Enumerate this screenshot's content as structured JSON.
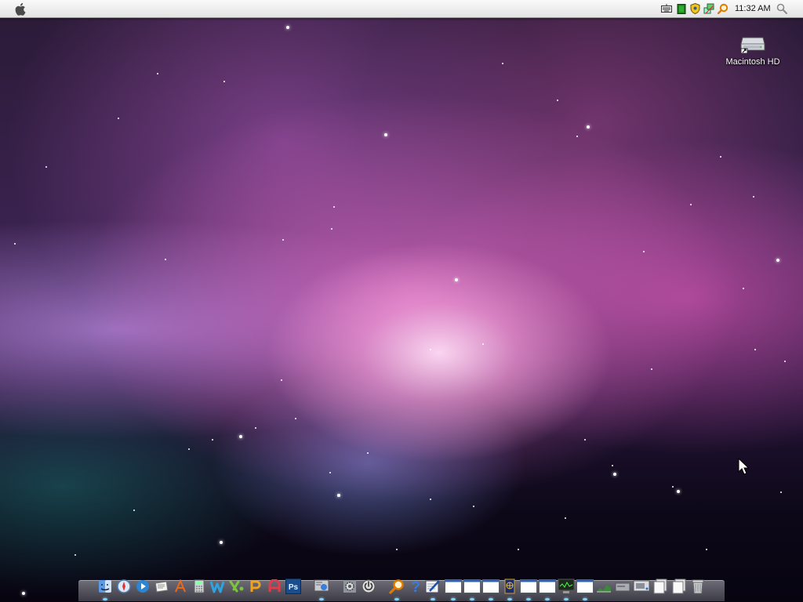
{
  "menubar": {
    "clock": "11:32 AM",
    "tray_icons": [
      "keyboard-icon",
      "battery-chip-icon",
      "security-shield-icon",
      "network-icon",
      "magnifier-tray-icon",
      "spotlight-icon"
    ]
  },
  "desktop": {
    "icons": [
      {
        "label": "Macintosh HD",
        "icon": "hard-drive-icon"
      }
    ]
  },
  "dock": {
    "items": [
      {
        "name": "finder",
        "icon": "finder-icon",
        "running": true
      },
      {
        "name": "safari",
        "icon": "safari-compass-icon"
      },
      {
        "name": "media-player",
        "icon": "media-player-icon"
      },
      {
        "name": "mail",
        "icon": "mail-icon"
      },
      {
        "name": "app-store",
        "icon": "app-store-icon"
      },
      {
        "name": "calculator",
        "icon": "calculator-icon"
      },
      {
        "name": "word",
        "icon": "w-icon"
      },
      {
        "name": "excel",
        "icon": "x-icon"
      },
      {
        "name": "powerpoint",
        "icon": "p-icon"
      },
      {
        "name": "access",
        "icon": "a-icon"
      },
      {
        "name": "photoshop",
        "icon": "photoshop-icon",
        "label": "Ps"
      },
      {
        "name": "network-settings",
        "icon": "network-settings-icon",
        "running": true
      },
      {
        "name": "system-preferences",
        "icon": "gear-icon"
      },
      {
        "name": "power",
        "icon": "power-icon"
      },
      {
        "name": "search",
        "icon": "search-icon",
        "running": true
      },
      {
        "name": "help",
        "icon": "help-icon",
        "label": "?"
      },
      {
        "name": "editor",
        "icon": "edit-icon",
        "running": true
      },
      {
        "name": "window-1",
        "icon": "window-icon",
        "running": true
      },
      {
        "name": "window-2",
        "icon": "window-icon",
        "running": true
      },
      {
        "name": "window-3",
        "icon": "window-icon",
        "running": true
      },
      {
        "name": "sync",
        "icon": "globe-window-icon",
        "running": true
      },
      {
        "name": "window-4",
        "icon": "window-icon",
        "running": true
      },
      {
        "name": "window-5",
        "icon": "window-icon",
        "running": true
      },
      {
        "name": "activity-monitor",
        "icon": "monitor-icon",
        "running": true
      },
      {
        "name": "window-6",
        "icon": "window-icon",
        "running": true
      },
      {
        "name": "chart",
        "icon": "chart-icon"
      },
      {
        "name": "drive",
        "icon": "drive-icon"
      },
      {
        "name": "display",
        "icon": "display-icon"
      },
      {
        "name": "documents-stack",
        "icon": "stack-icon"
      },
      {
        "name": "downloads-stack",
        "icon": "stack-icon"
      },
      {
        "name": "trash",
        "icon": "trash-icon"
      }
    ]
  },
  "colors": {
    "menubar": "#e8e8e8",
    "dock_indicator": "#7fd8ff",
    "wallpaper_glow": "#f6b6e6"
  }
}
